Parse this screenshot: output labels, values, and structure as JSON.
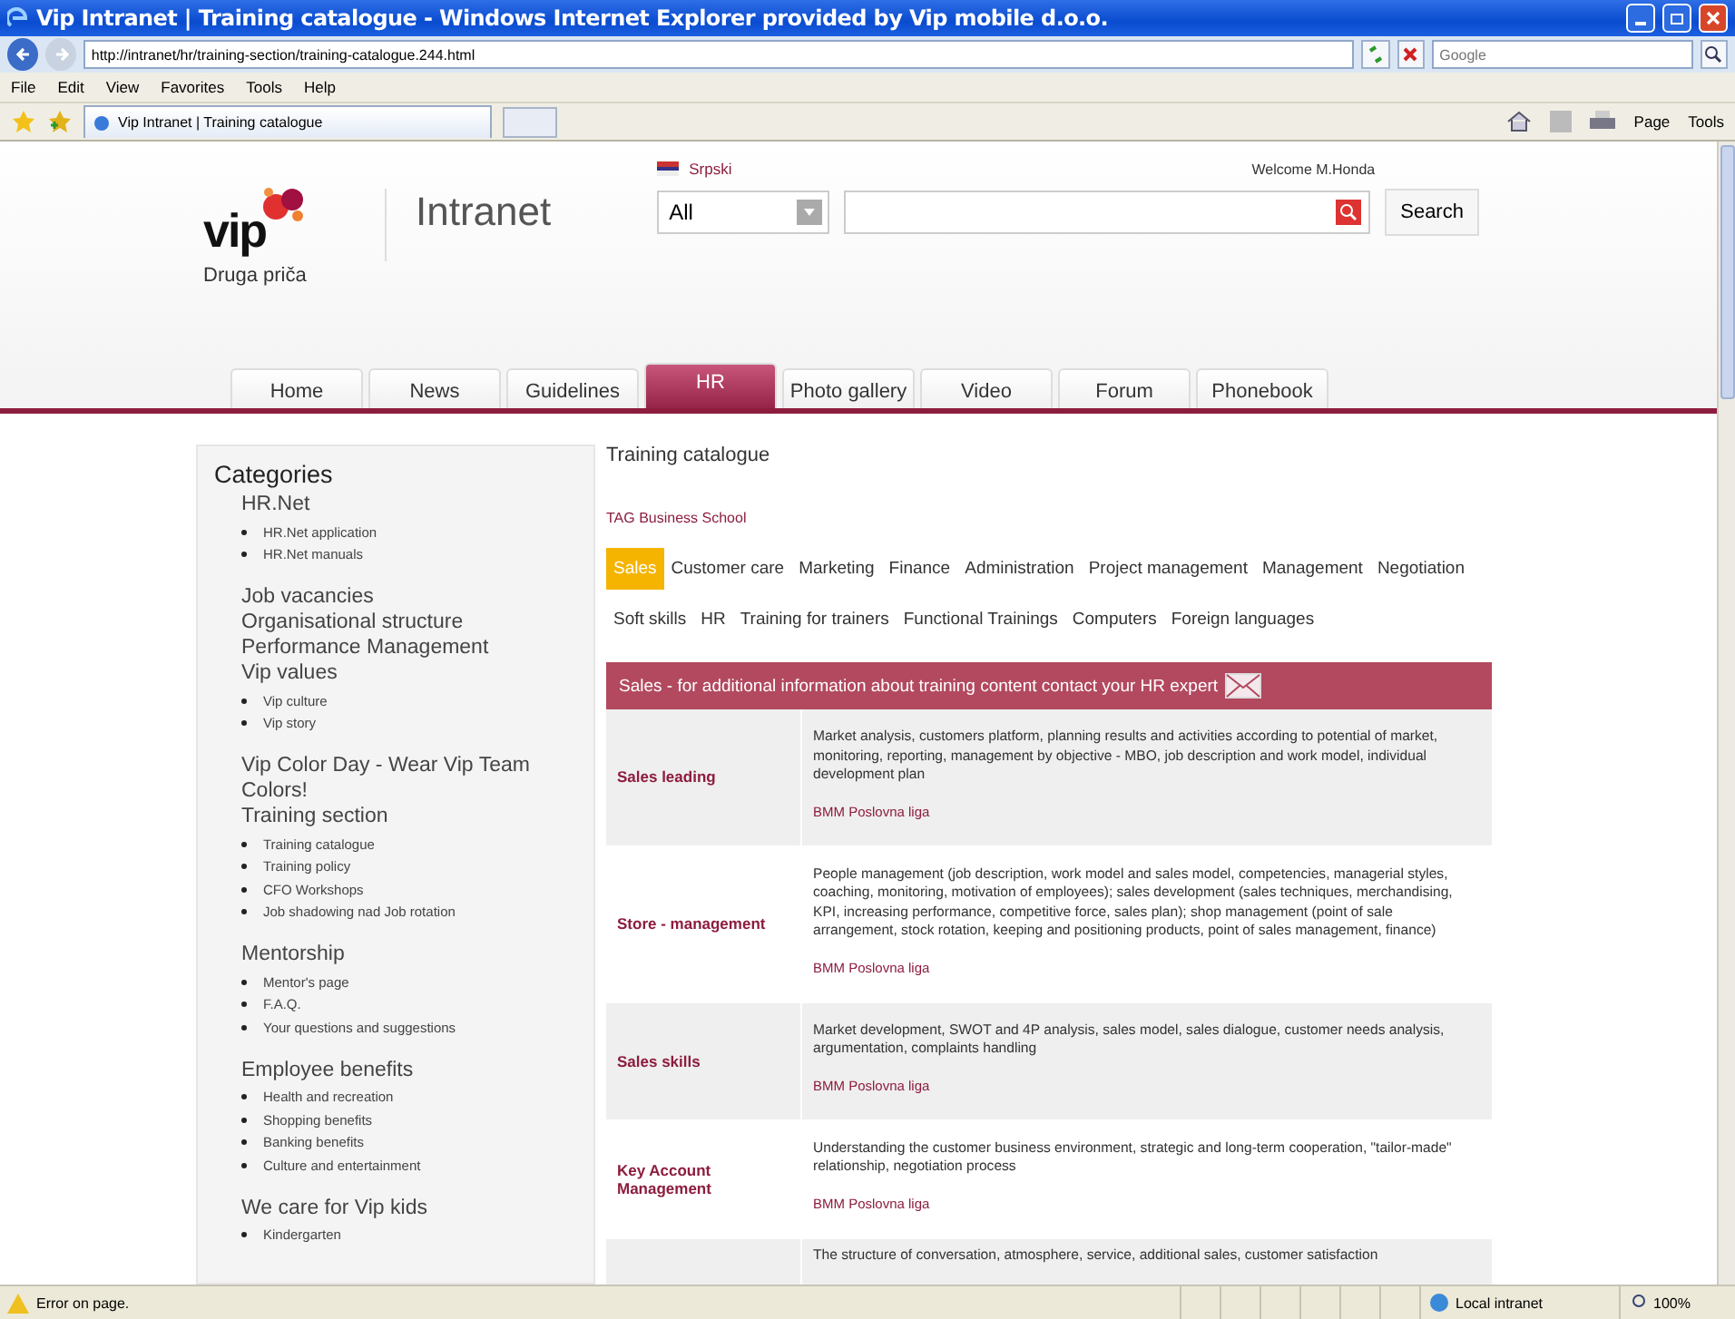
{
  "window": {
    "title": "Vip Intranet | Training catalogue - Windows Internet Explorer provided by Vip mobile d.o.o."
  },
  "address_bar": {
    "url": "http://intranet/hr/training-section/training-catalogue.244.html",
    "search_placeholder": "Google"
  },
  "menu": [
    "File",
    "Edit",
    "View",
    "Favorites",
    "Tools",
    "Help"
  ],
  "browser_tab": {
    "title": "Vip Intranet | Training catalogue"
  },
  "command_bar": [
    "Page",
    "Tools"
  ],
  "header": {
    "logo": "vip",
    "slogan": "Druga priča",
    "site_name": "Intranet",
    "language": "Srpski",
    "welcome": "Welcome M.Honda",
    "search_scope": "All",
    "search_button": "Search"
  },
  "nav_tabs": [
    {
      "label": "Home",
      "selected": false
    },
    {
      "label": "News",
      "selected": false
    },
    {
      "label": "Guidelines",
      "selected": false
    },
    {
      "label": "HR",
      "selected": true
    },
    {
      "label": "Photo gallery",
      "selected": false
    },
    {
      "label": "Video",
      "selected": false
    },
    {
      "label": "Forum",
      "selected": false
    },
    {
      "label": "Phonebook",
      "selected": false
    }
  ],
  "sidebar": {
    "heading": "Categories",
    "sections": [
      {
        "title": "HR.Net",
        "items": [
          "HR.Net application",
          "HR.Net manuals"
        ]
      },
      {
        "title": "Job vacancies"
      },
      {
        "title": "Organisational structure"
      },
      {
        "title": "Performance Management"
      },
      {
        "title": "Vip values",
        "items": [
          "Vip culture",
          "Vip story"
        ]
      },
      {
        "title": "Vip Color Day - Wear Vip Team Colors!"
      },
      {
        "title": "Training section",
        "items": [
          "Training catalogue",
          "Training policy",
          "CFO Workshops",
          "Job shadowing nad Job rotation"
        ]
      },
      {
        "title": "Mentorship",
        "items": [
          "Mentor's page",
          "F.A.Q.",
          "Your questions and suggestions"
        ]
      },
      {
        "title": "Employee benefits",
        "items": [
          "Health and recreation",
          "Shopping benefits",
          "Banking benefits",
          "Culture and entertainment"
        ]
      },
      {
        "title": "We care for Vip kids",
        "items": [
          "Kindergarten"
        ]
      }
    ]
  },
  "content": {
    "title": "Training catalogue",
    "school": "TAG Business School",
    "categories": [
      {
        "label": "Sales",
        "selected": true
      },
      {
        "label": "Customer care",
        "selected": false
      },
      {
        "label": "Marketing",
        "selected": false
      },
      {
        "label": "Finance",
        "selected": false
      },
      {
        "label": "Administration",
        "selected": false
      },
      {
        "label": "Project management",
        "selected": false
      },
      {
        "label": "Management",
        "selected": false
      },
      {
        "label": "Negotiation",
        "selected": false
      },
      {
        "label": "Soft skills",
        "selected": false
      },
      {
        "label": "HR",
        "selected": false
      },
      {
        "label": "Training for trainers",
        "selected": false
      },
      {
        "label": "Functional Trainings",
        "selected": false
      },
      {
        "label": "Computers",
        "selected": false
      },
      {
        "label": "Foreign languages",
        "selected": false
      }
    ],
    "banner": "Sales - for additional information about training content contact your HR expert",
    "rows": [
      {
        "name": "Sales leading",
        "description": "Market analysis, customers platform, planning results and activities according to potential of market, monitoring, reporting, management by objective - MBO, job description and work model, individual development plan",
        "provider": "BMM Poslovna liga"
      },
      {
        "name": "Store - management",
        "description": "People management (job description, work model and sales model, competencies, managerial styles, coaching, monitoring, motivation of employees); sales development (sales techniques, merchandising, KPI, increasing performance, competitive force, sales plan); shop management (point of sale arrangement, stock rotation, keeping and positioning products, point of sales management, finance)",
        "provider": "BMM Poslovna liga"
      },
      {
        "name": "Sales skills",
        "description": "Market development, SWOT and 4P analysis, sales model, sales dialogue, customer needs analysis, argumentation, complaints handling",
        "provider": "BMM Poslovna liga"
      },
      {
        "name": "Key Account Management",
        "description": "Understanding the customer business environment, strategic and long-term cooperation, \"tailor-made\" relationship, negotiation process",
        "provider": "BMM Poslovna liga"
      },
      {
        "description": "The structure of conversation, atmosphere, service, additional sales, customer satisfaction"
      }
    ]
  },
  "status_bar": {
    "message": "Error on page.",
    "zone": "Local intranet",
    "zoom": "100%"
  }
}
